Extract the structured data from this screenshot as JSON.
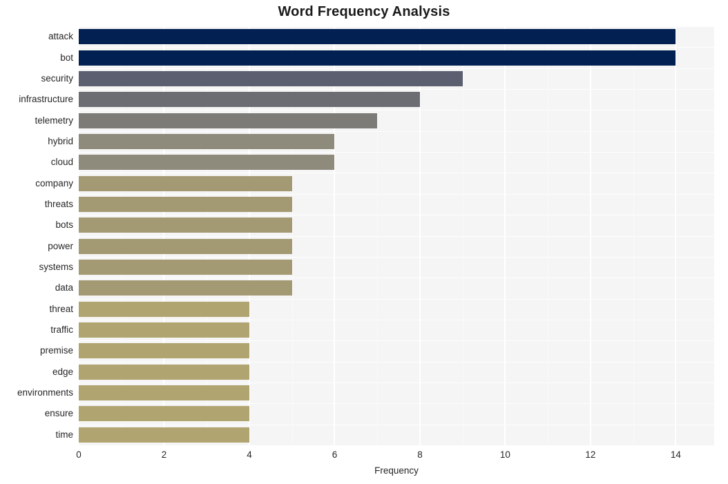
{
  "chart_data": {
    "type": "bar",
    "orientation": "horizontal",
    "title": "Word Frequency Analysis",
    "xlabel": "Frequency",
    "ylabel": "",
    "xlim": [
      0,
      14.9
    ],
    "xticks": [
      0,
      2,
      4,
      6,
      8,
      10,
      12,
      14
    ],
    "xtick_labels": [
      "0",
      "2",
      "4",
      "6",
      "8",
      "10",
      "12",
      "14"
    ],
    "grid": true,
    "grid_axis": "x",
    "legend": "none",
    "plot_background": "#f5f5f5",
    "figure_background": "#ffffff",
    "categories": [
      "attack",
      "bot",
      "security",
      "infrastructure",
      "telemetry",
      "hybrid",
      "cloud",
      "company",
      "threats",
      "bots",
      "power",
      "systems",
      "data",
      "threat",
      "traffic",
      "premise",
      "edge",
      "environments",
      "ensure",
      "time"
    ],
    "values": [
      14,
      14,
      9,
      8,
      7,
      6,
      6,
      5,
      5,
      5,
      5,
      5,
      5,
      4,
      4,
      4,
      4,
      4,
      4,
      4
    ],
    "bar_colors": [
      "#022051",
      "#022051",
      "#5b5f70",
      "#6c6d73",
      "#7c7b77",
      "#8e8a7c",
      "#8e8a7c",
      "#a39a74",
      "#a39a74",
      "#a39a74",
      "#a39a74",
      "#a39a74",
      "#a39a74",
      "#b0a470",
      "#b0a470",
      "#b0a470",
      "#b0a470",
      "#b0a470",
      "#b0a470",
      "#b0a470"
    ]
  }
}
